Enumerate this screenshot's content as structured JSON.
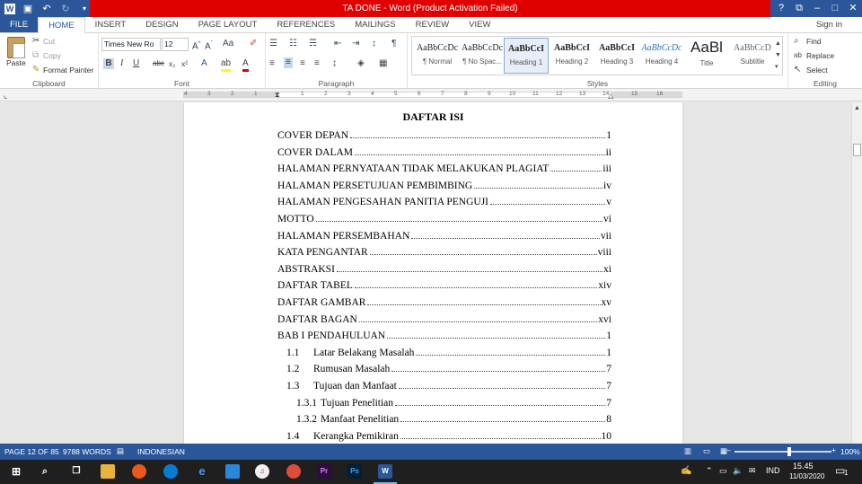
{
  "window": {
    "title": "TA DONE -  Word (Product Activation Failed)",
    "quick_access": [
      "word-icon",
      "save-icon",
      "undo-icon",
      "redo-icon",
      "customize-icon"
    ],
    "controls": [
      "?",
      "⧉",
      "–",
      "□",
      "✕"
    ]
  },
  "tabs": [
    "FILE",
    "HOME",
    "INSERT",
    "DESIGN",
    "PAGE LAYOUT",
    "REFERENCES",
    "MAILINGS",
    "REVIEW",
    "VIEW"
  ],
  "active_tab": "HOME",
  "signin": "Sign in",
  "ribbon": {
    "clipboard": {
      "label": "Clipboard",
      "paste": "Paste",
      "cut": "Cut",
      "copy": "Copy",
      "format_painter": "Format Painter"
    },
    "font": {
      "label": "Font",
      "font_name": "Times New Ro",
      "font_size": "12",
      "bold": "B",
      "italic": "I",
      "underline": "U",
      "strike": "abc",
      "sub": "x₂",
      "sup": "x²"
    },
    "paragraph": {
      "label": "Paragraph"
    },
    "styles": {
      "label": "Styles",
      "items": [
        {
          "preview": "AaBbCcDc",
          "name": "¶ Normal"
        },
        {
          "preview": "AaBbCcDc",
          "name": "¶ No Spac..."
        },
        {
          "preview": "AaBbCcI",
          "name": "Heading 1"
        },
        {
          "preview": "AaBbCcI",
          "name": "Heading 2"
        },
        {
          "preview": "AaBbCcI",
          "name": "Heading 3"
        },
        {
          "preview": "AaBbCcDc",
          "name": "Heading 4"
        },
        {
          "preview": "AaBl",
          "name": "Title"
        },
        {
          "preview": "AaBbCcD",
          "name": "Subtitle"
        }
      ]
    },
    "editing": {
      "label": "Editing",
      "find": "Find",
      "replace": "Replace",
      "select": "Select"
    }
  },
  "ruler": {
    "labels": [
      "4",
      "3",
      "2",
      "1",
      "1",
      "2",
      "3",
      "4",
      "5",
      "6",
      "7",
      "8",
      "9",
      "10",
      "11",
      "12",
      "13",
      "14",
      "15",
      "16"
    ]
  },
  "document": {
    "title": "DAFTAR ISI",
    "toc": [
      {
        "num": "",
        "text": "COVER DEPAN",
        "page": "1",
        "level": 0
      },
      {
        "num": "",
        "text": "COVER DALAM",
        "page": "ii",
        "level": 0
      },
      {
        "num": "",
        "text": "HALAMAN PERNYATAAN TIDAK MELAKUKAN PLAGIAT",
        "page": "iii",
        "level": 0
      },
      {
        "num": "",
        "text": "HALAMAN PERSETUJUAN PEMBIMBING",
        "page": "iv",
        "level": 0
      },
      {
        "num": "",
        "text": "HALAMAN PENGESAHAN PANITIA PENGUJI",
        "page": "v",
        "level": 0
      },
      {
        "num": "",
        "text": "MOTTO",
        "page": "vi",
        "level": 0
      },
      {
        "num": "",
        "text": "HALAMAN PERSEMBAHAN",
        "page": "vii",
        "level": 0
      },
      {
        "num": "",
        "text": "KATA PENGANTAR",
        "page": "viii",
        "level": 0
      },
      {
        "num": "",
        "text": "ABSTRAKSI",
        "page": "xi",
        "level": 0
      },
      {
        "num": "",
        "text": "DAFTAR TABEL",
        "page": "xiv",
        "level": 0
      },
      {
        "num": "",
        "text": "DAFTAR GAMBAR",
        "page": "xv",
        "level": 0
      },
      {
        "num": "",
        "text": "DAFTAR BAGAN",
        "page": "xvi",
        "level": 0
      },
      {
        "num": "",
        "text": "BAB I PENDAHULUAN",
        "page": "1",
        "level": 0
      },
      {
        "num": "1.1",
        "text": "Latar Belakang Masalah",
        "page": "1",
        "level": 1
      },
      {
        "num": "1.2",
        "text": "Rumusan Masalah",
        "page": "7",
        "level": 1
      },
      {
        "num": "1.3",
        "text": "Tujuan dan Manfaat",
        "page": "7",
        "level": 1
      },
      {
        "num": "1.3.1",
        "text": "Tujuan Penelitian",
        "page": "7",
        "level": 2
      },
      {
        "num": "1.3.2",
        "text": "Manfaat Penelitian",
        "page": "8",
        "level": 2
      },
      {
        "num": "1.4",
        "text": "Kerangka Pemikiran",
        "page": "10",
        "level": 1
      }
    ]
  },
  "status": {
    "page": "PAGE 12 OF 85",
    "words": "9788 WORDS",
    "language": "INDONESIAN",
    "zoom": "100%"
  },
  "taskbar": {
    "time": "15.45",
    "date": "11/03/2020",
    "lang": "IND",
    "notifications": "1"
  }
}
